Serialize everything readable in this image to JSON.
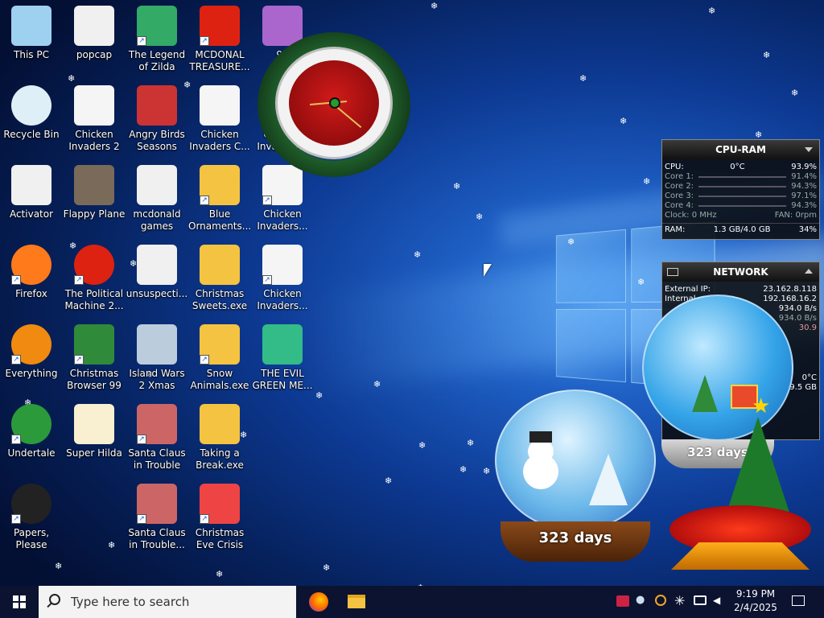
{
  "desktop_icons": [
    {
      "label": "This PC",
      "icon": "computer-icon",
      "shortcut": false
    },
    {
      "label": "Recycle Bin",
      "icon": "recycle-bin-icon",
      "shortcut": false
    },
    {
      "label": "Activator",
      "icon": "folder-icon",
      "shortcut": false
    },
    {
      "label": "Firefox",
      "icon": "firefox-icon",
      "shortcut": true
    },
    {
      "label": "Everything",
      "icon": "search-ring-icon",
      "shortcut": true
    },
    {
      "label": "Undertale",
      "icon": "undertale-icon",
      "shortcut": true
    },
    {
      "label": "Papers, Please",
      "icon": "papers-please-icon",
      "shortcut": true
    },
    {
      "label": "popcap",
      "icon": "folder-icon",
      "shortcut": false
    },
    {
      "label": "Chicken Invaders 2",
      "icon": "chicken-icon",
      "shortcut": false
    },
    {
      "label": "Flappy Plane",
      "icon": "plane-icon",
      "shortcut": false
    },
    {
      "label": "The Political Machine 2...",
      "icon": "political-machine-icon",
      "shortcut": true
    },
    {
      "label": "Christmas Browser 99",
      "icon": "christmas-tree-icon",
      "shortcut": true
    },
    {
      "label": "Super Hilda",
      "icon": "super-hilda-icon",
      "shortcut": false
    },
    {
      "label": "The Legend of Zilda",
      "icon": "zilda-icon",
      "shortcut": true
    },
    {
      "label": "Angry Birds Seasons",
      "icon": "angry-birds-icon",
      "shortcut": false
    },
    {
      "label": "mcdonald games",
      "icon": "folder-icon",
      "shortcut": false
    },
    {
      "label": "unsuspecti...",
      "icon": "folder-icon",
      "shortcut": false
    },
    {
      "label": "Island Wars 2 Xmas",
      "icon": "island-icon",
      "shortcut": false
    },
    {
      "label": "Santa Claus in Trouble",
      "icon": "santa-icon",
      "shortcut": true
    },
    {
      "label": "Santa Claus in Trouble... A...",
      "icon": "santa-icon",
      "shortcut": true
    },
    {
      "label": "MCDONAL TREASURE...",
      "icon": "mcdonalds-icon",
      "shortcut": true
    },
    {
      "label": "Chicken Invaders C...",
      "icon": "chicken-icon",
      "shortcut": false
    },
    {
      "label": "Blue Ornaments....",
      "icon": "star-exe-icon",
      "shortcut": true
    },
    {
      "label": "Christmas Sweets.exe",
      "icon": "star-exe-icon",
      "shortcut": false
    },
    {
      "label": "Snow Animals.exe",
      "icon": "star-exe-icon",
      "shortcut": true
    },
    {
      "label": "Taking a Break.exe",
      "icon": "star-exe-icon",
      "shortcut": false
    },
    {
      "label": "Christmas Eve Crisis",
      "icon": "santa-hat-icon",
      "shortcut": true
    },
    {
      "label": "95",
      "icon": "game-icon",
      "shortcut": false
    },
    {
      "label": "Chicken Invaders...",
      "icon": "chicken-icon",
      "shortcut": true
    },
    {
      "label": "Chicken Invaders...",
      "icon": "chicken-icon",
      "shortcut": true
    },
    {
      "label": "Chicken Invaders...",
      "icon": "chicken-icon",
      "shortcut": true
    },
    {
      "label": "THE EVIL GREEN ME...",
      "icon": "messenger-icon",
      "shortcut": false
    }
  ],
  "cpu_ram": {
    "title": "CPU-RAM",
    "cpu_label": "CPU:",
    "cpu_temp": "0°C",
    "cpu_pct": "93.9%",
    "cores": [
      {
        "label": "Core 1:",
        "value": "91.4%"
      },
      {
        "label": "Core 2:",
        "value": "94.3%"
      },
      {
        "label": "Core 3:",
        "value": "97.1%"
      },
      {
        "label": "Core 4:",
        "value": "94.3%"
      }
    ],
    "clock": "Clock: 0 MHz",
    "fan": "FAN: 0rpm",
    "ram_label": "RAM:",
    "ram_value": "1.3 GB/4.0 GB",
    "ram_pct": "34%"
  },
  "network": {
    "title": "NETWORK",
    "ext_ip_label": "External IP:",
    "ext_ip": "23.162.8.118",
    "int_ip_label": "Internal",
    "int_ip": "192.168.16.2",
    "rate1": "934.0 B/s",
    "rate2": "934.0 B/s",
    "rate3": "30.9",
    "temp": "0°C",
    "size": "9.5 GB"
  },
  "snow_globe_main": {
    "text": "323 days"
  },
  "snow_globe_back": {
    "text": "323 days"
  },
  "taskbar": {
    "search_placeholder": "Type here to search",
    "time": "9:19 PM",
    "date": "2/4/2025"
  },
  "colors": {
    "accent": "#1e5fc4",
    "taskbar": "#0b1330"
  }
}
